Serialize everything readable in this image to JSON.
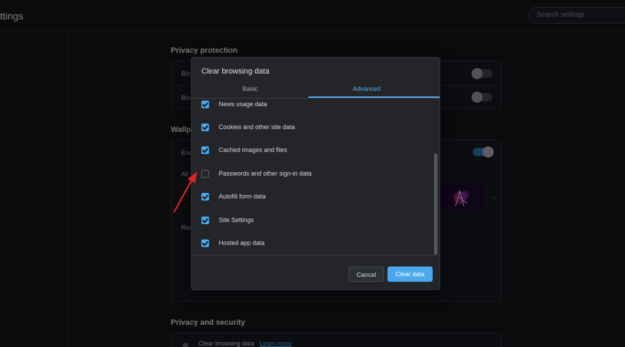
{
  "header": {
    "title": "ttings",
    "search_placeholder": "Search settings"
  },
  "background": {
    "privacy_protection": {
      "title": "Privacy protection",
      "rows": [
        {
          "label": "Blo",
          "toggle": false
        },
        {
          "label": "Blo",
          "toggle": false
        }
      ]
    },
    "wallpapers": {
      "title": "Wallp",
      "rows": [
        {
          "label": "Ena",
          "toggle": true
        },
        {
          "label": "All"
        },
        {
          "label": "Rec"
        }
      ]
    },
    "privacy_security": {
      "title": "Privacy and security",
      "clear_browsing_label": "Clear browsing data",
      "learn_more": "Learn more"
    }
  },
  "dialog": {
    "title": "Clear browsing data",
    "tabs": [
      {
        "label": "Basic",
        "active": false
      },
      {
        "label": "Advanced",
        "active": true
      }
    ],
    "items": [
      {
        "label": "News usage data",
        "checked": true
      },
      {
        "label": "Cookies and other site data",
        "checked": true
      },
      {
        "label": "Cached images and files",
        "checked": true
      },
      {
        "label": "Passwords and other sign-in data",
        "checked": false
      },
      {
        "label": "Autofill form data",
        "checked": true
      },
      {
        "label": "Site Settings",
        "checked": true
      },
      {
        "label": "Hosted app data",
        "checked": true
      }
    ],
    "buttons": {
      "cancel": "Cancel",
      "clear": "Clear data"
    }
  },
  "colors": {
    "accent": "#4aa8ec",
    "annotation_arrow": "#e02424"
  },
  "icons": {
    "checkbox": "check-icon",
    "chevron": "chevron-right-icon",
    "annotation": "red-arrow-icon"
  }
}
